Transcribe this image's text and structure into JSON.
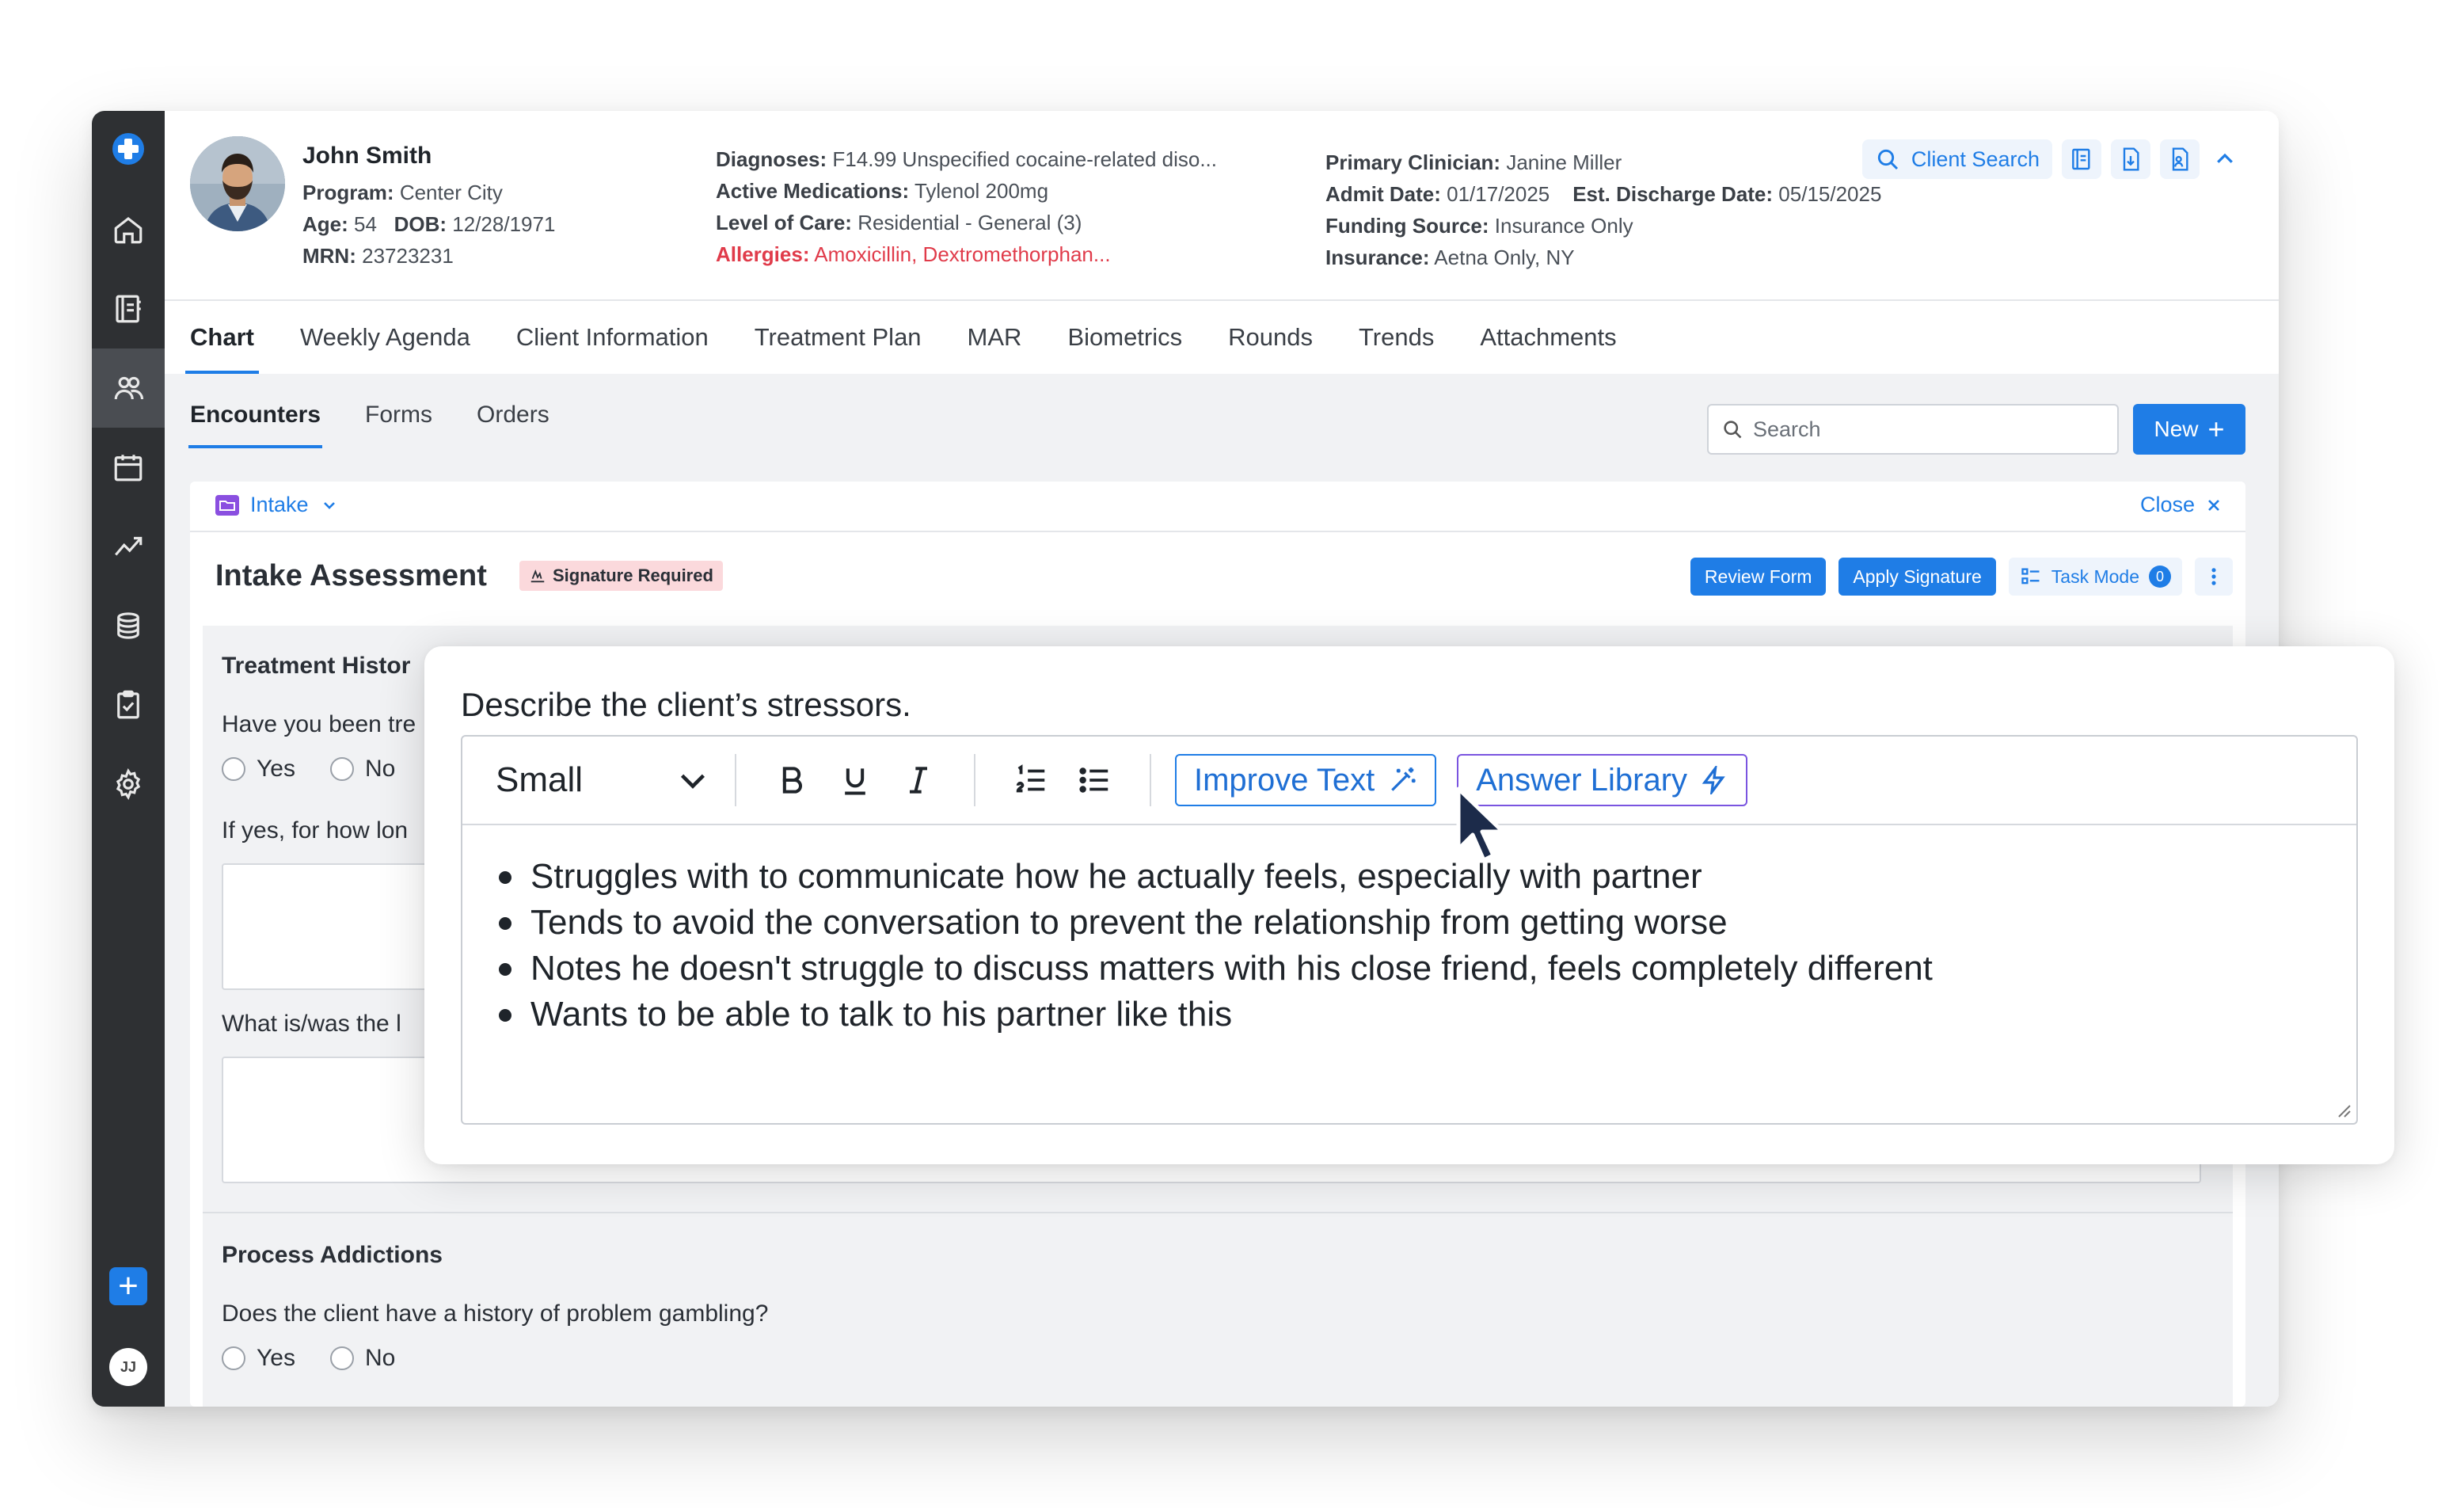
{
  "client": {
    "name": "John Smith",
    "program_label": "Program:",
    "program": "Center City",
    "age_label": "Age:",
    "age": "54",
    "dob_label": "DOB:",
    "dob": "12/28/1971",
    "mrn_label": "MRN:",
    "mrn": "23723231",
    "diagnoses_label": "Diagnoses:",
    "diagnoses": "F14.99 Unspecified cocaine-related diso...",
    "medications_label": "Active Medications:",
    "medications": "Tylenol 200mg",
    "level_of_care_label": "Level of Care:",
    "level_of_care": "Residential - General (3)",
    "allergies_label": "Allergies:",
    "allergies": "Amoxicillin, Dextromethorphan...",
    "clinician_label": "Primary Clinician:",
    "clinician": "Janine Miller",
    "admit_label": "Admit Date:",
    "admit_date": "01/17/2025",
    "discharge_label": "Est. Discharge Date:",
    "discharge_date": "05/15/2025",
    "funding_label": "Funding Source:",
    "funding": "Insurance Only",
    "insurance_label": "Insurance:",
    "insurance": "Aetna Only, NY"
  },
  "header_actions": {
    "client_search_label": "Client Search"
  },
  "tabs": [
    {
      "label": "Chart"
    },
    {
      "label": "Weekly Agenda"
    },
    {
      "label": "Client Information"
    },
    {
      "label": "Treatment Plan"
    },
    {
      "label": "MAR"
    },
    {
      "label": "Biometrics"
    },
    {
      "label": "Rounds"
    },
    {
      "label": "Trends"
    },
    {
      "label": "Attachments"
    }
  ],
  "subtabs": [
    {
      "label": "Encounters"
    },
    {
      "label": "Forms"
    },
    {
      "label": "Orders"
    }
  ],
  "search": {
    "placeholder": "Search"
  },
  "new_button": {
    "label": "New"
  },
  "form": {
    "folder_label": "Intake",
    "close_label": "Close",
    "title": "Intake Assessment",
    "signature_badge": "Signature Required",
    "review_label": "Review Form",
    "apply_label": "Apply Signature",
    "task_mode_label": "Task Mode",
    "task_count": "0"
  },
  "background_form": {
    "section1_title": "Treatment Histor",
    "q1": "Have you been tre",
    "q2": "If yes, for how lon",
    "q3": "What is/was the l",
    "section2_title": "Process Addictions",
    "q4": "Does the client have a history of problem gambling?",
    "yes_label": "Yes",
    "no_label": "No"
  },
  "popup": {
    "question": "Describe the client’s stressors.",
    "size_value": "Small",
    "improve_label": "Improve Text",
    "library_label": "Answer Library",
    "bullets": [
      "Struggles with to communicate how he actually feels, especially with partner",
      "Tends to avoid the conversation to prevent the relationship from getting worse",
      "Notes he doesn't struggle to discuss matters with his close friend, feels completely different",
      "Wants to be able to talk to his partner like this"
    ]
  },
  "sidebar": {
    "avatar_initials": "JJ"
  },
  "colors": {
    "accent": "#1f7de6",
    "sidebar": "#2e3033",
    "allergy": "#e03b4a",
    "badge": "#fbd9dc",
    "library_border": "#7a55e0"
  }
}
